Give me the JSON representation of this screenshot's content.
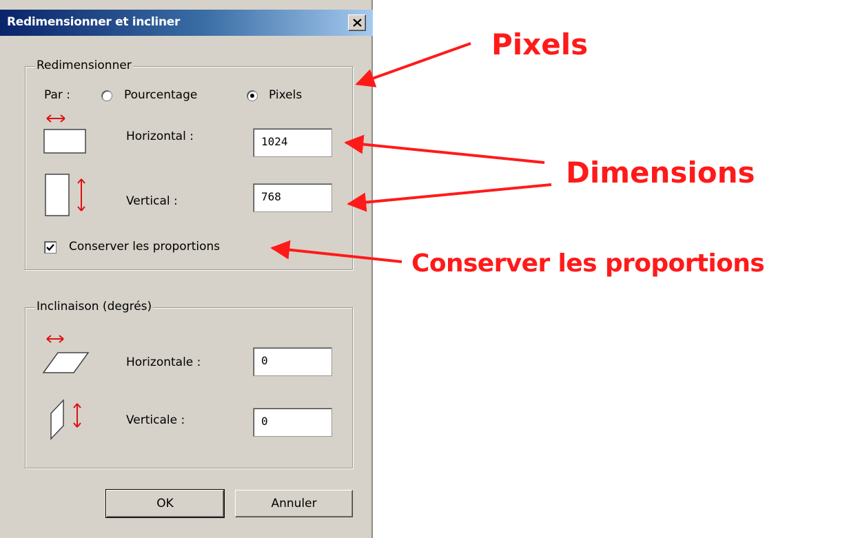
{
  "dialog": {
    "title": "Redimensionner et incliner",
    "close_symbol": "×"
  },
  "resize": {
    "group_label": "Redimensionner",
    "by_label": "Par :",
    "percent_label": "Pourcentage",
    "pixels_label": "Pixels",
    "selected_mode": "Pixels",
    "horizontal_label": "Horizontal :",
    "horizontal_value": "1024",
    "vertical_label": "Vertical :",
    "vertical_value": "768",
    "keep_ratio_label": "Conserver les proportions",
    "keep_ratio_checked": true
  },
  "skew": {
    "group_label": "Inclinaison (degrés)",
    "horizontal_label": "Horizontale :",
    "horizontal_value": "0",
    "vertical_label": "Verticale :",
    "vertical_value": "0"
  },
  "buttons": {
    "ok_label": "OK",
    "cancel_label": "Annuler"
  },
  "annotations": {
    "pixels": "Pixels",
    "dimensions": "Dimensions",
    "keep_ratio": "Conserver les proportions",
    "color": "#ff1a1a"
  },
  "icons": [
    "close-icon",
    "horizontal-resize-icon",
    "vertical-resize-icon",
    "horizontal-skew-icon",
    "vertical-skew-icon",
    "checkmark-icon"
  ]
}
